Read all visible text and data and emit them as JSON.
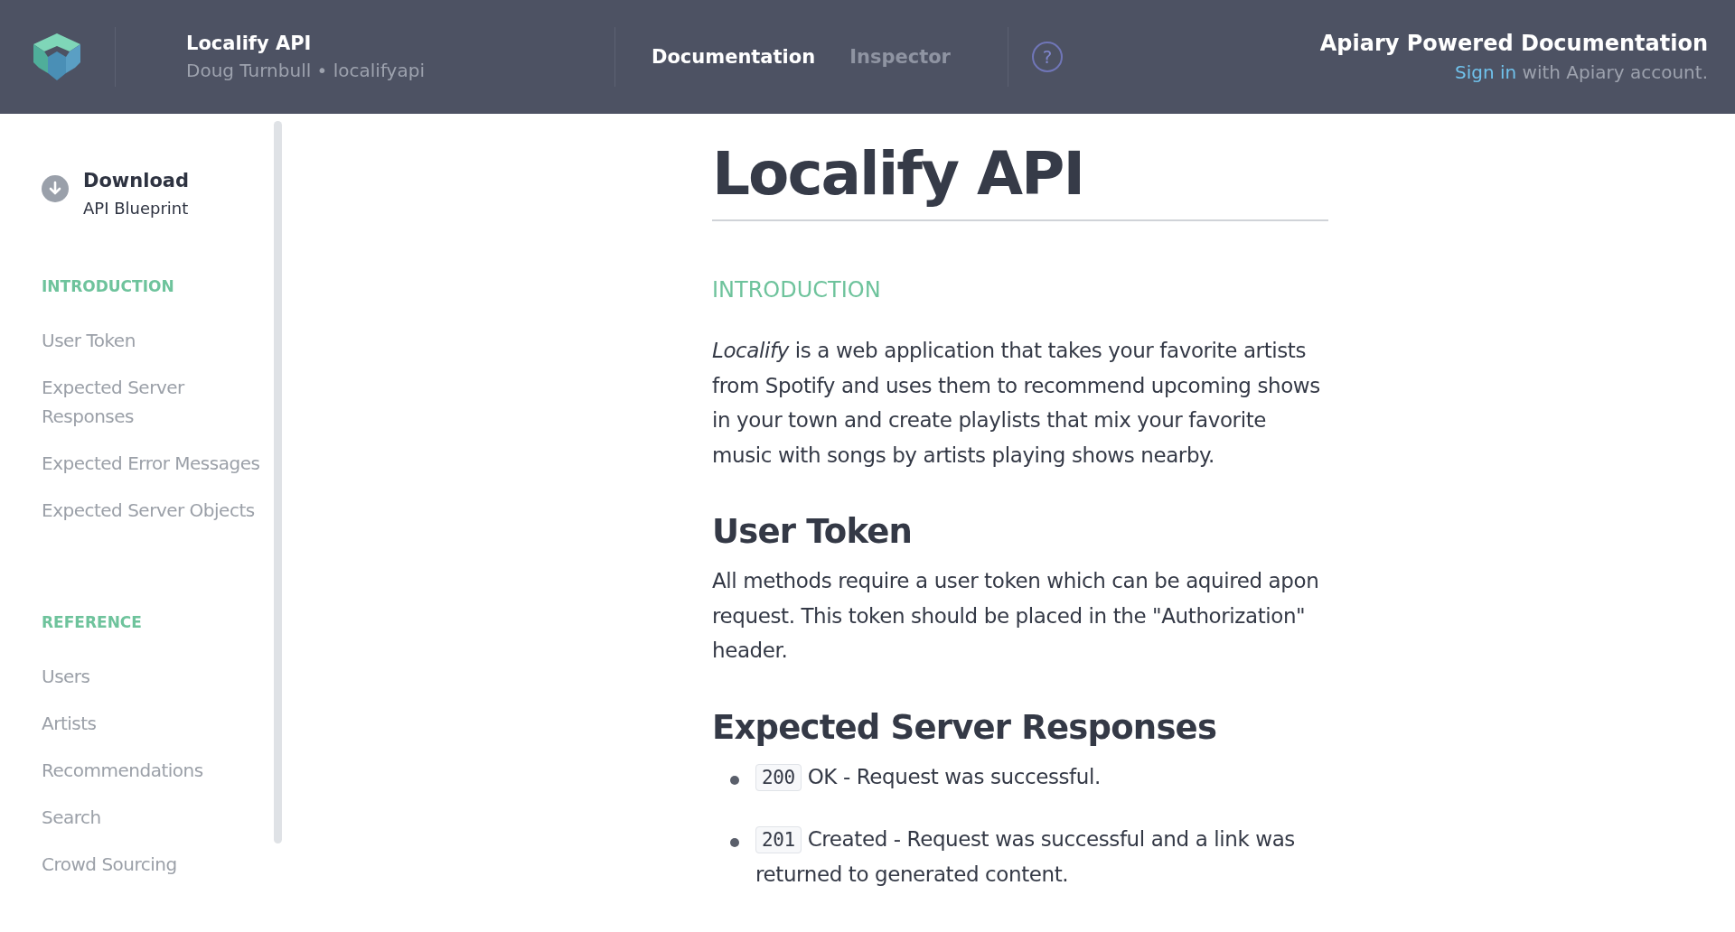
{
  "header": {
    "project_title": "Localify API",
    "project_subtitle": "Doug Turnbull • localifyapi",
    "nav": [
      {
        "label": "Documentation",
        "selected": true
      },
      {
        "label": "Inspector",
        "selected": false
      }
    ],
    "help": "?",
    "brand_title": "Apiary Powered Documentation",
    "sign_in_link": "Sign in",
    "sign_in_rest": " with Apiary account."
  },
  "sidebar": {
    "download_title": "Download",
    "download_subtitle": "API Blueprint",
    "sections": [
      {
        "heading": "INTRODUCTION",
        "items": [
          "User Token",
          "Expected Server Responses",
          "Expected Error Messages",
          "Expected Server Objects"
        ]
      },
      {
        "heading": "REFERENCE",
        "items": [
          "Users",
          "Artists",
          "Recommendations",
          "Search",
          "Crowd Sourcing"
        ]
      }
    ]
  },
  "content": {
    "title": "Localify API",
    "section_label": "INTRODUCTION",
    "intro": "*Localify* is a web application that takes your favorite artists from Spotify and uses them to recommend upcoming shows in your town and create playlists that mix your favorite music with songs by artists playing shows nearby.",
    "h_user_token": "User Token",
    "user_token_text": "All methods require a user token which can be aquired apon request. This token should be placed in the \"Authorization\" header.",
    "h_responses": "Expected Server Responses",
    "responses": [
      {
        "code": "200",
        "text": "OK - Request was successful."
      },
      {
        "code": "201",
        "text": "Created - Request was successful and a link was returned to generated content."
      }
    ]
  }
}
